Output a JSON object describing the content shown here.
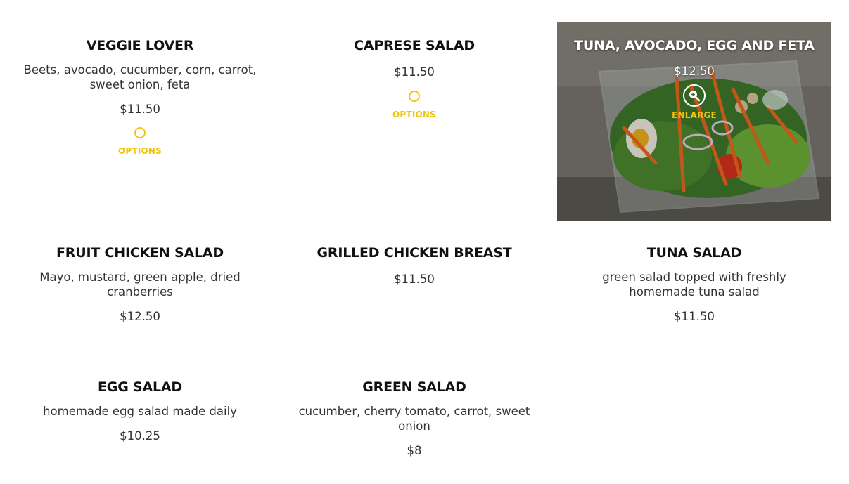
{
  "accent_color": "#f1c40f",
  "items": [
    {
      "title": "VEGGIE LOVER",
      "description": "Beets, avocado, cucumber, corn, carrot, sweet onion, feta",
      "price": "$11.50",
      "options_label": "OPTIONS",
      "options_icon": "circle-option-icon"
    },
    {
      "title": "CAPRESE SALAD",
      "description": "",
      "price": "$11.50",
      "options_label": "OPTIONS",
      "options_icon": "circle-option-icon"
    },
    {
      "title": "TUNA, AVOCADO, EGG AND FETA",
      "description": "",
      "price": "$12.50",
      "enlarge_label": "ENLARGE",
      "enlarge_icon": "zoom-in-icon"
    },
    {
      "title": "FRUIT CHICKEN SALAD",
      "description": "Mayo, mustard, green apple, dried cranberries",
      "price": "$12.50"
    },
    {
      "title": "GRILLED CHICKEN BREAST",
      "description": "",
      "price": "$11.50"
    },
    {
      "title": "TUNA SALAD",
      "description": "green salad topped with freshly homemade tuna salad",
      "price": "$11.50"
    },
    {
      "title": "EGG SALAD",
      "description": "homemade egg salad made daily",
      "price": "$10.25"
    },
    {
      "title": "GREEN SALAD",
      "description": "cucumber, cherry tomato, carrot, sweet onion",
      "price": "$8"
    }
  ]
}
